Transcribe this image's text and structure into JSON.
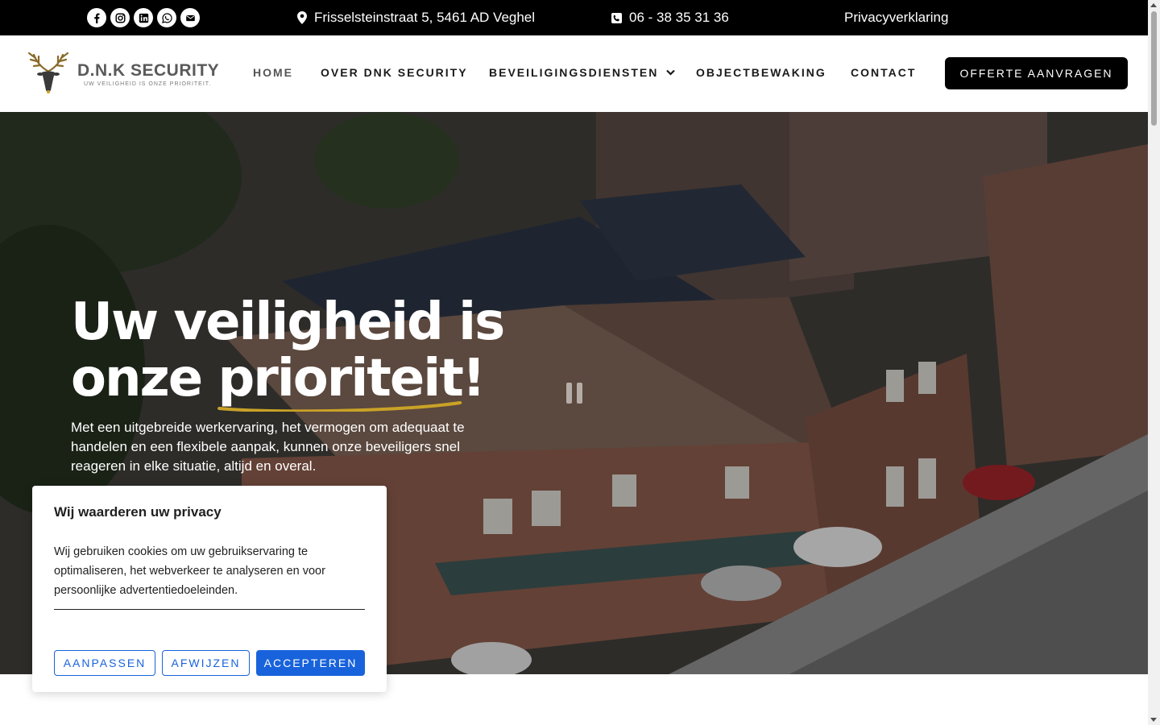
{
  "topbar": {
    "social_icons": [
      "facebook-icon",
      "instagram-icon",
      "linkedin-icon",
      "whatsapp-icon",
      "envelope-icon"
    ],
    "address": "Frisselsteinstraat 5, 5461 AD Veghel",
    "phone": "06 - 38 35 31 36",
    "privacy": "Privacyverklaring"
  },
  "header": {
    "logo_name": "D.N.K SECURITY",
    "logo_tagline": "UW VEILIGHEID IS ONZE PRIORITEIT.",
    "nav": {
      "home": "HOME",
      "over": "OVER DNK SECURITY",
      "beveiligingsdiensten": "BEVEILIGINGSDIENSTEN",
      "objectbewaking": "OBJECTBEWAKING",
      "contact": "CONTACT"
    },
    "cta": "OFFERTE AANVRAGEN"
  },
  "hero": {
    "title_line1": "Uw veiligheid is",
    "title_line2_prefix": "onze ",
    "title_highlight": "prioriteit",
    "title_suffix": "!",
    "text": "Met een uitgebreide werkervaring, het vermogen om adequaat te handelen en een flexibele aanpak, kunnen onze beveiligers snel reageren in elke situatie, altijd en overal."
  },
  "cookie": {
    "title": "Wij waarderen uw privacy",
    "text": "Wij gebruiken cookies om uw gebruikservaring te optimaliseren, het webverkeer te analyseren en voor persoonlijke advertentiedoeleinden.",
    "customize": "AANPASSEN",
    "reject": "AFWIJZEN",
    "accept": "ACCEPTEREN"
  },
  "colors": {
    "topbar_bg": "#000000",
    "accent_gold": "#c9a227",
    "cookie_blue": "#1863dc"
  }
}
